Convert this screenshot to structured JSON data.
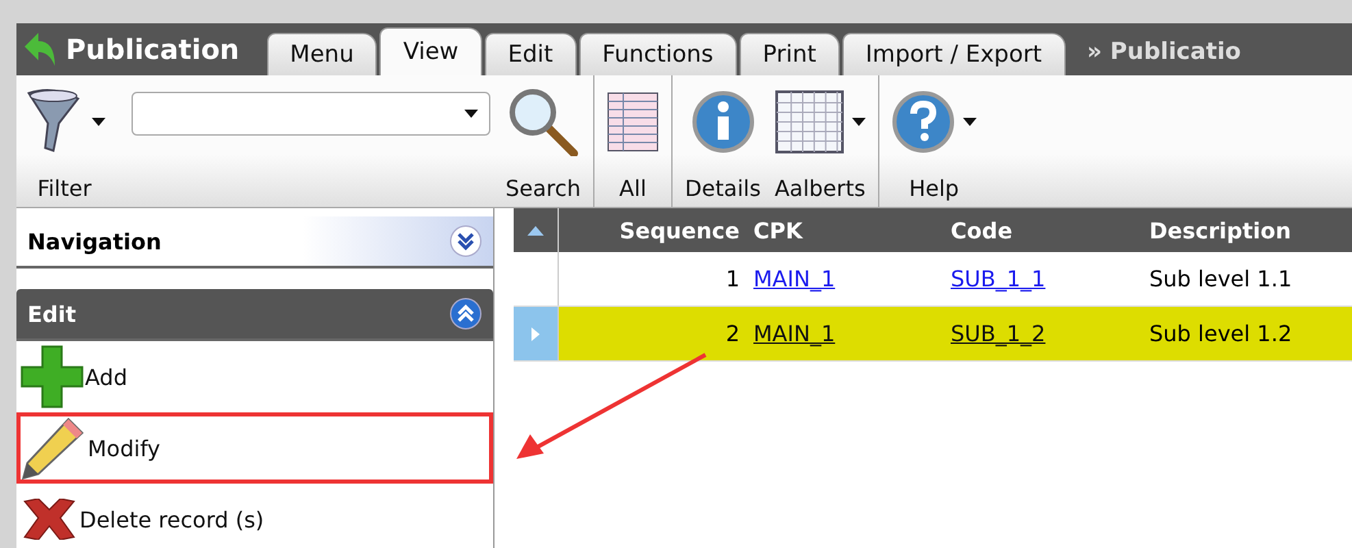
{
  "app": {
    "title": "Publication"
  },
  "tabs": [
    {
      "label": "Menu",
      "selected": false
    },
    {
      "label": "View",
      "selected": true
    },
    {
      "label": "Edit",
      "selected": false
    },
    {
      "label": "Functions",
      "selected": false
    },
    {
      "label": "Print",
      "selected": false
    },
    {
      "label": "Import / Export",
      "selected": false
    }
  ],
  "breadcrumb": "» Publicatio",
  "toolbar": {
    "items": [
      {
        "kind": "funnel",
        "label": "Filter",
        "dropdown": true,
        "group_start": false
      },
      {
        "kind": "combo",
        "group_start": false
      },
      {
        "kind": "magnifier",
        "label": "Search",
        "dropdown": false,
        "group_start": false
      },
      {
        "kind": "table",
        "label": "All",
        "dropdown": false,
        "group_start": true
      },
      {
        "kind": "info",
        "label": "Details",
        "dropdown": false,
        "group_start": true
      },
      {
        "kind": "grid",
        "label": "Aalberts",
        "dropdown": true,
        "group_start": false
      },
      {
        "kind": "question",
        "label": "Help",
        "dropdown": true,
        "group_start": true
      }
    ]
  },
  "sidebar": {
    "panels": [
      {
        "title": "Navigation",
        "expanded": false
      },
      {
        "title": "Edit",
        "expanded": true,
        "items": [
          {
            "label": "Add",
            "kind": "plus",
            "annotated": false
          },
          {
            "label": "Modify",
            "kind": "pencil",
            "annotated": true
          },
          {
            "label": "Delete record (s)",
            "kind": "cross",
            "annotated": false
          }
        ]
      }
    ]
  },
  "table": {
    "columns": [
      "Sequence",
      "CPK",
      "Code",
      "Description"
    ],
    "rows": [
      {
        "sequence": "1",
        "cpk": "MAIN_1",
        "code": "SUB_1_1",
        "description": "Sub level 1.1",
        "selected": false
      },
      {
        "sequence": "2",
        "cpk": "MAIN_1",
        "code": "SUB_1_2",
        "description": "Sub level 1.2",
        "selected": true
      }
    ]
  }
}
